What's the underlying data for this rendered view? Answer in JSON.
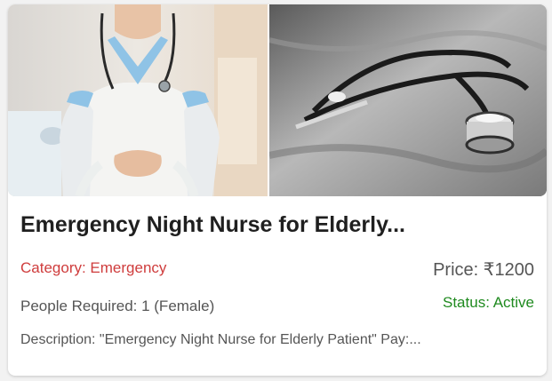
{
  "listing": {
    "images": {
      "left_alt": "nurse-photo",
      "right_alt": "stethoscope-photo"
    },
    "title": "Emergency Night Nurse for Elderly...",
    "category": "Category: Emergency",
    "price": "Price: ₹1200",
    "people_required": "People Required: 1 (Female)",
    "status": "Status: Active",
    "description": "Description: \"Emergency Night Nurse for Elderly Patient\" Pay:..."
  },
  "colors": {
    "category": "#cf3c3c",
    "status": "#1f8a1f",
    "title": "#1f1f1f",
    "muted": "#555555"
  }
}
